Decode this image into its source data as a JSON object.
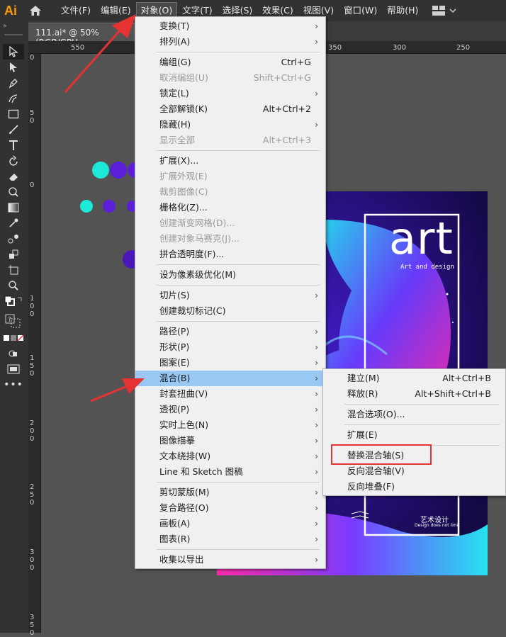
{
  "app": {
    "logo": "Ai"
  },
  "menubar": {
    "items": [
      {
        "label": "文件(F)"
      },
      {
        "label": "编辑(E)"
      },
      {
        "label": "对象(O)",
        "active": true
      },
      {
        "label": "文字(T)"
      },
      {
        "label": "选择(S)"
      },
      {
        "label": "效果(C)"
      },
      {
        "label": "视图(V)"
      },
      {
        "label": "窗口(W)"
      },
      {
        "label": "帮助(H)"
      }
    ]
  },
  "document": {
    "tab_title": "111.ai* @ 50% (RGB/GPU"
  },
  "ruler": {
    "h_labels": [
      "550",
      "350",
      "300",
      "250"
    ],
    "v_labels": [
      "0",
      "50",
      "0",
      "100",
      "150",
      "200",
      "250",
      "300",
      "350"
    ]
  },
  "object_menu": {
    "groups": [
      [
        {
          "label": "变换(T)",
          "submenu": true
        },
        {
          "label": "排列(A)",
          "submenu": true
        }
      ],
      [
        {
          "label": "编组(G)",
          "shortcut": "Ctrl+G"
        },
        {
          "label": "取消编组(U)",
          "shortcut": "Shift+Ctrl+G",
          "disabled": true
        },
        {
          "label": "锁定(L)",
          "submenu": true
        },
        {
          "label": "全部解锁(K)",
          "shortcut": "Alt+Ctrl+2"
        },
        {
          "label": "隐藏(H)",
          "submenu": true
        },
        {
          "label": "显示全部",
          "shortcut": "Alt+Ctrl+3",
          "disabled": true
        }
      ],
      [
        {
          "label": "扩展(X)..."
        },
        {
          "label": "扩展外观(E)",
          "disabled": true
        },
        {
          "label": "裁剪图像(C)",
          "disabled": true
        },
        {
          "label": "栅格化(Z)..."
        },
        {
          "label": "创建渐变网格(D)...",
          "disabled": true
        },
        {
          "label": "创建对象马赛克(J)...",
          "disabled": true
        },
        {
          "label": "拼合透明度(F)..."
        }
      ],
      [
        {
          "label": "设为像素级优化(M)"
        }
      ],
      [
        {
          "label": "切片(S)",
          "submenu": true
        },
        {
          "label": "创建裁切标记(C)"
        }
      ],
      [
        {
          "label": "路径(P)",
          "submenu": true
        },
        {
          "label": "形状(P)",
          "submenu": true
        },
        {
          "label": "图案(E)",
          "submenu": true
        },
        {
          "label": "混合(B)",
          "submenu": true,
          "highlight": true
        },
        {
          "label": "封套扭曲(V)",
          "submenu": true
        },
        {
          "label": "透视(P)",
          "submenu": true
        },
        {
          "label": "实时上色(N)",
          "submenu": true
        },
        {
          "label": "图像描摹",
          "submenu": true
        },
        {
          "label": "文本绕排(W)",
          "submenu": true
        },
        {
          "label": "Line 和 Sketch 图稿",
          "submenu": true
        }
      ],
      [
        {
          "label": "剪切蒙版(M)",
          "submenu": true
        },
        {
          "label": "复合路径(O)",
          "submenu": true
        },
        {
          "label": "画板(A)",
          "submenu": true
        },
        {
          "label": "图表(R)",
          "submenu": true
        }
      ],
      [
        {
          "label": "收集以导出",
          "submenu": true
        }
      ]
    ]
  },
  "blend_submenu": {
    "groups": [
      [
        {
          "label": "建立(M)",
          "shortcut": "Alt+Ctrl+B"
        },
        {
          "label": "释放(R)",
          "shortcut": "Alt+Shift+Ctrl+B"
        }
      ],
      [
        {
          "label": "混合选项(O)..."
        }
      ],
      [
        {
          "label": "扩展(E)"
        }
      ],
      [
        {
          "label": "替换混合轴(S)",
          "boxed": true
        },
        {
          "label": "反向混合轴(V)"
        },
        {
          "label": "反向堆叠(F)"
        }
      ]
    ]
  },
  "poster": {
    "title": "art",
    "subtitle": "Art and design",
    "footer_title": "艺术设计",
    "footer_sub": "Design does not limit"
  },
  "colors": {
    "accent_highlight": "#99c8f5",
    "annotation_red": "#e53333",
    "cyan_dot": "#1de9d9",
    "purple_dot": "#5a1fd6",
    "poster_bg": "#2a0f6a"
  },
  "icons": {
    "home": "home-icon",
    "workspace": "workspace-grid-icon"
  }
}
